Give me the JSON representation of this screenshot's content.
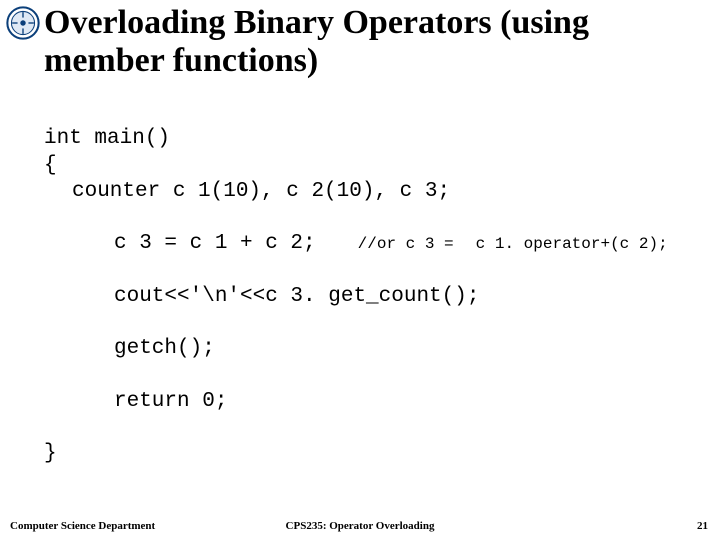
{
  "title": "Overloading Binary Operators (using member functions)",
  "code": {
    "l1": "int main()",
    "l2": "{",
    "l3": "counter c 1(10), c 2(10), c 3;",
    "l4a": "c 3 = c 1 + c 2;",
    "l4b": "//or c 3 =",
    "l4c": "c 1. operator+(c 2);",
    "l5": "cout<<'\\n'<<c 3. get_count();",
    "l6": "getch();",
    "l7": "return 0;",
    "l8": "}"
  },
  "footer": {
    "left": "Computer Science Department",
    "mid": "CPS235: Operator Overloading",
    "right": "21"
  },
  "icons": {
    "logo": "institution-seal-icon"
  }
}
